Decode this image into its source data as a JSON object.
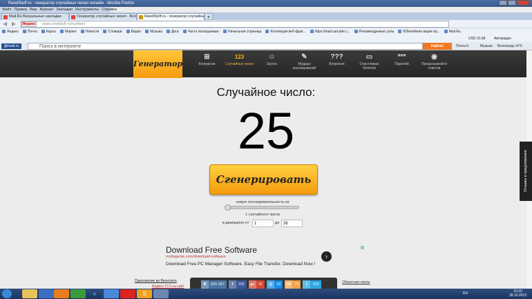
{
  "window": {
    "title": "RandStuff.ru - генератор случайных чисел онлайн - Mozilla Firefox"
  },
  "menu": [
    "Файл",
    "Правка",
    "Вид",
    "Журнал",
    "Закладки",
    "Инструменты",
    "Справка"
  ],
  "tabs": [
    {
      "label": "Mail.Ru Визуальные закладки"
    },
    {
      "label": "Генератор случайных чисел - Всё о..."
    },
    {
      "label": "RandStuff.ru - генератор случайных...",
      "active": true
    }
  ],
  "address": {
    "engine": "Яндекс",
    "url": "www.randstuff.ru/number/"
  },
  "bookmarks": [
    "Яндекс",
    "Почта",
    "Карты",
    "Маркет",
    "Новости",
    "Словари",
    "Видео",
    "Музыка",
    "Диск",
    "Часто посещаемые",
    "Начальная страница",
    "Коллекция веб-фраг...",
    "https://mail.carcade.c...",
    "Рекомендуемые узлы",
    "Юбилейная акция пр...",
    "Mail.Ru"
  ],
  "toolbar2": {
    "usd": "USD 31.68",
    "radio": "Авторадио"
  },
  "mailbar": {
    "logo": "@mail.ru",
    "search_placeholder": "Поиск в интернете",
    "find": "Найти!",
    "mail": "Почта 5",
    "music": "Музыка",
    "weather": "Волгоград +6°С"
  },
  "site": {
    "logo": "Генератор",
    "nav": [
      {
        "icon": "gift-icon",
        "glyph": "⊞",
        "label": "Конкурсов"
      },
      {
        "icon": "numbers-icon",
        "glyph": "123",
        "label": "Случайных чисел",
        "active": true
      },
      {
        "icon": "smiley-icon",
        "glyph": "☺",
        "label": "Шуток"
      },
      {
        "icon": "quote-icon",
        "glyph": "✎",
        "label": "Мудрых высказываний"
      },
      {
        "icon": "question-icon",
        "glyph": "???",
        "label": "Вопросов"
      },
      {
        "icon": "ticket-icon",
        "glyph": "▭",
        "label": "Счастливых билетов"
      },
      {
        "icon": "password-icon",
        "glyph": "***",
        "label": "Паролей"
      },
      {
        "icon": "ball-icon",
        "glyph": "◉",
        "label": "Предсказаний и ответов"
      }
    ]
  },
  "main": {
    "heading": "Случайное число:",
    "number": "25",
    "generate": "Сгенерировать",
    "seq_label": "новую последовательность из",
    "count_label": "1 случайного числа",
    "range_from_label": "в диапазоне от",
    "range_from": "1",
    "range_to_label": "до",
    "range_to": "36",
    "slider_value": 1
  },
  "ad": {
    "title": "Download Free Software",
    "url": "mobogenie.com/download-software",
    "desc": "Download Free PC Manager Software. Easy File Transfer. Download Now !"
  },
  "footer": {
    "vk_app": "Приложение во Вконтакте",
    "widget": "Виджет ГСЧ на сайт",
    "feedback": "Обратная связь",
    "social": [
      {
        "icon": "vk-icon",
        "g": "В",
        "count": "655 087",
        "color": "#4c75a3"
      },
      {
        "icon": "facebook-icon",
        "g": "f",
        "count": "291",
        "color": "#3b5998"
      },
      {
        "icon": "googleplus-icon",
        "g": "g+",
        "count": "41",
        "color": "#d34836"
      },
      {
        "icon": "mailru-icon",
        "g": "@",
        "count": "34",
        "color": "#168de2"
      },
      {
        "icon": "odnoklassniki-icon",
        "g": "ok",
        "count": "76",
        "color": "#f2a24a"
      },
      {
        "icon": "twitter-icon",
        "g": "t",
        "count": "259",
        "color": "#2ca7e0"
      }
    ]
  },
  "sidetab": "Отзывы и предложения",
  "taskbar": {
    "lang": "RU",
    "time": "10:10",
    "date": "28.10.2013"
  }
}
